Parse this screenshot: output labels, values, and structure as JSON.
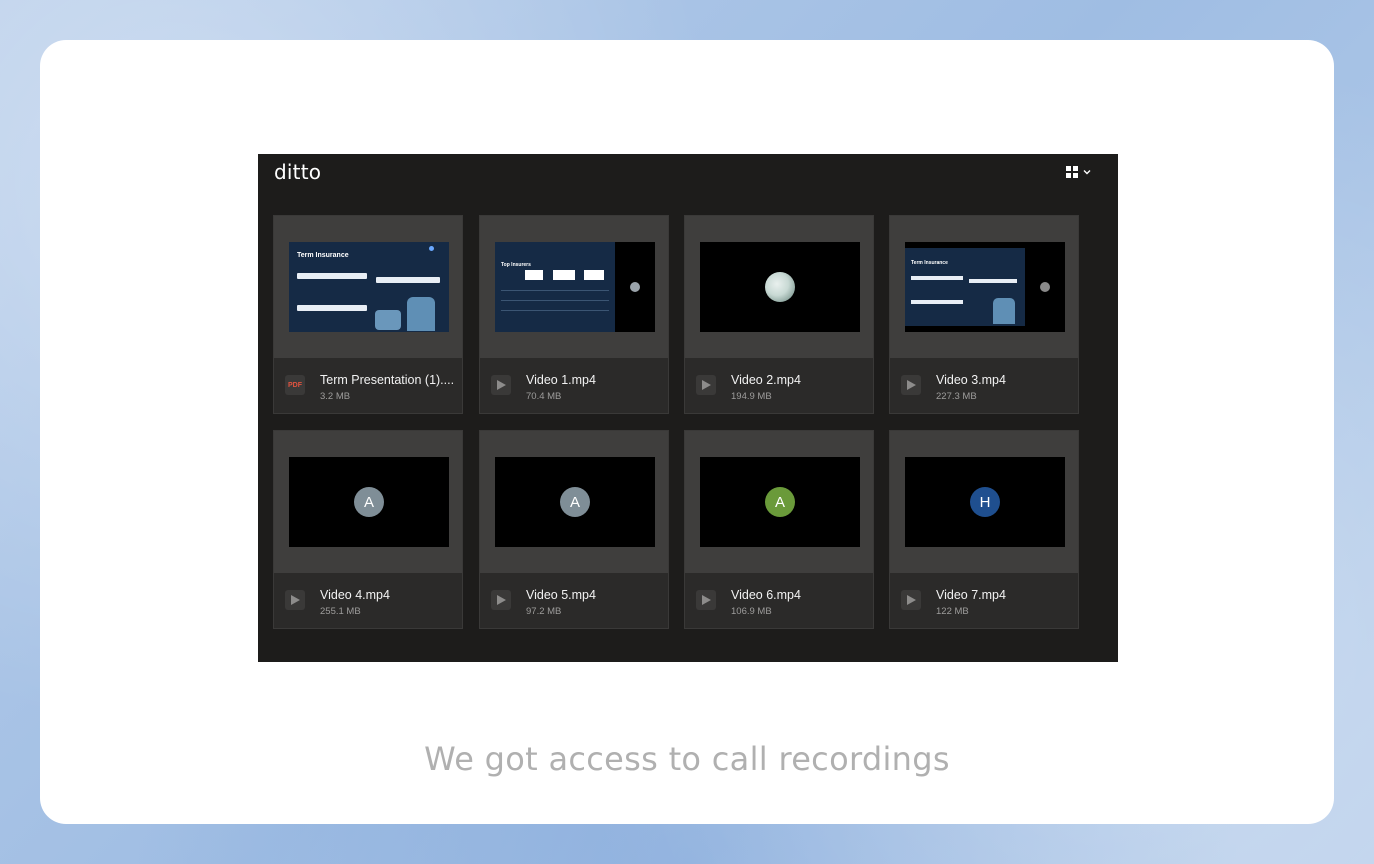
{
  "app": {
    "logo": "ditto",
    "view_toggle_icon": "grid-view-icon"
  },
  "files": [
    {
      "name": "Term Presentation (1)....",
      "size": "3.2 MB",
      "type": "pdf",
      "icon_label": "PDF",
      "thumb": "slide-term"
    },
    {
      "name": "Video 1.mp4",
      "size": "70.4 MB",
      "type": "video",
      "thumb": "slide-insurers"
    },
    {
      "name": "Video 2.mp4",
      "size": "194.9 MB",
      "type": "video",
      "thumb": "photo-avatar"
    },
    {
      "name": "Video 3.mp4",
      "size": "227.3 MB",
      "type": "video",
      "thumb": "slide-term-call"
    },
    {
      "name": "Video 4.mp4",
      "size": "255.1 MB",
      "type": "video",
      "thumb": "letter-avatar",
      "avatar_letter": "A",
      "avatar_color": "#7f8e97"
    },
    {
      "name": "Video 5.mp4",
      "size": "97.2 MB",
      "type": "video",
      "thumb": "letter-avatar",
      "avatar_letter": "A",
      "avatar_color": "#7f8e97"
    },
    {
      "name": "Video 6.mp4",
      "size": "106.9 MB",
      "type": "video",
      "thumb": "letter-avatar",
      "avatar_letter": "A",
      "avatar_color": "#6a9a3a"
    },
    {
      "name": "Video 7.mp4",
      "size": "122 MB",
      "type": "video",
      "thumb": "letter-avatar",
      "avatar_letter": "H",
      "avatar_color": "#1f4f8f"
    }
  ],
  "slides": {
    "term_title": "Term Insurance",
    "insurers_title": "Top Insurers"
  },
  "caption": "We got access to call recordings",
  "colors": {
    "app_bg": "#1d1c1b",
    "caption": "#b0b0b0",
    "pdf_accent": "#e0533f"
  }
}
